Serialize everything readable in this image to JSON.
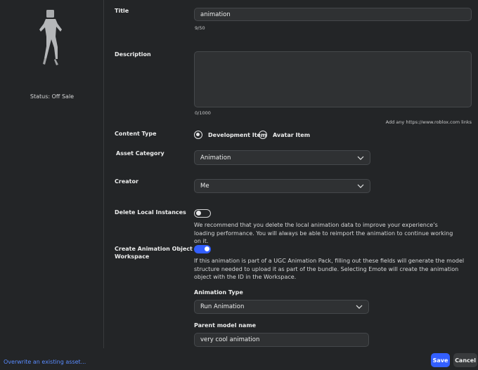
{
  "sidebar": {
    "status": "Status: Off Sale"
  },
  "title": {
    "label": "Title",
    "value": "animation",
    "counter": "9/50"
  },
  "description": {
    "label": "Description",
    "value": "",
    "counter": "0/1000",
    "hint": "Add any https://www.roblox.com links"
  },
  "content_type": {
    "label": "Content Type",
    "options": [
      "Development Item",
      "Avatar Item"
    ],
    "selected": "Development Item"
  },
  "asset_category": {
    "label": "Asset Category",
    "value": "Animation"
  },
  "creator": {
    "label": "Creator",
    "value": "Me"
  },
  "delete_local": {
    "label": "Delete Local Instances",
    "enabled": false,
    "text": "We recommend that you delete the local animation data to improve your experience’s loading performance. You will always be able to reimport the animation to continue working on it."
  },
  "create_object": {
    "label_line1": "Create Animation Object In",
    "label_line2": "Workspace",
    "enabled": true,
    "text": "If this animation is part of a UGC Animation Pack, filling out these fields will generate the model structure needed to upload it as part of the bundle. Selecting Emote will create the animation object with the ID in the Workspace."
  },
  "animation_type": {
    "label": "Animation Type",
    "value": "Run Animation"
  },
  "parent_model": {
    "label": "Parent model name",
    "value": "very cool animation"
  },
  "footer": {
    "overwrite_link": "Overwrite an existing asset...",
    "save": "Save",
    "cancel": "Cancel"
  },
  "colors": {
    "accent": "#335fff",
    "background": "#232527",
    "field": "#2f3133",
    "link": "#5a8cff"
  }
}
